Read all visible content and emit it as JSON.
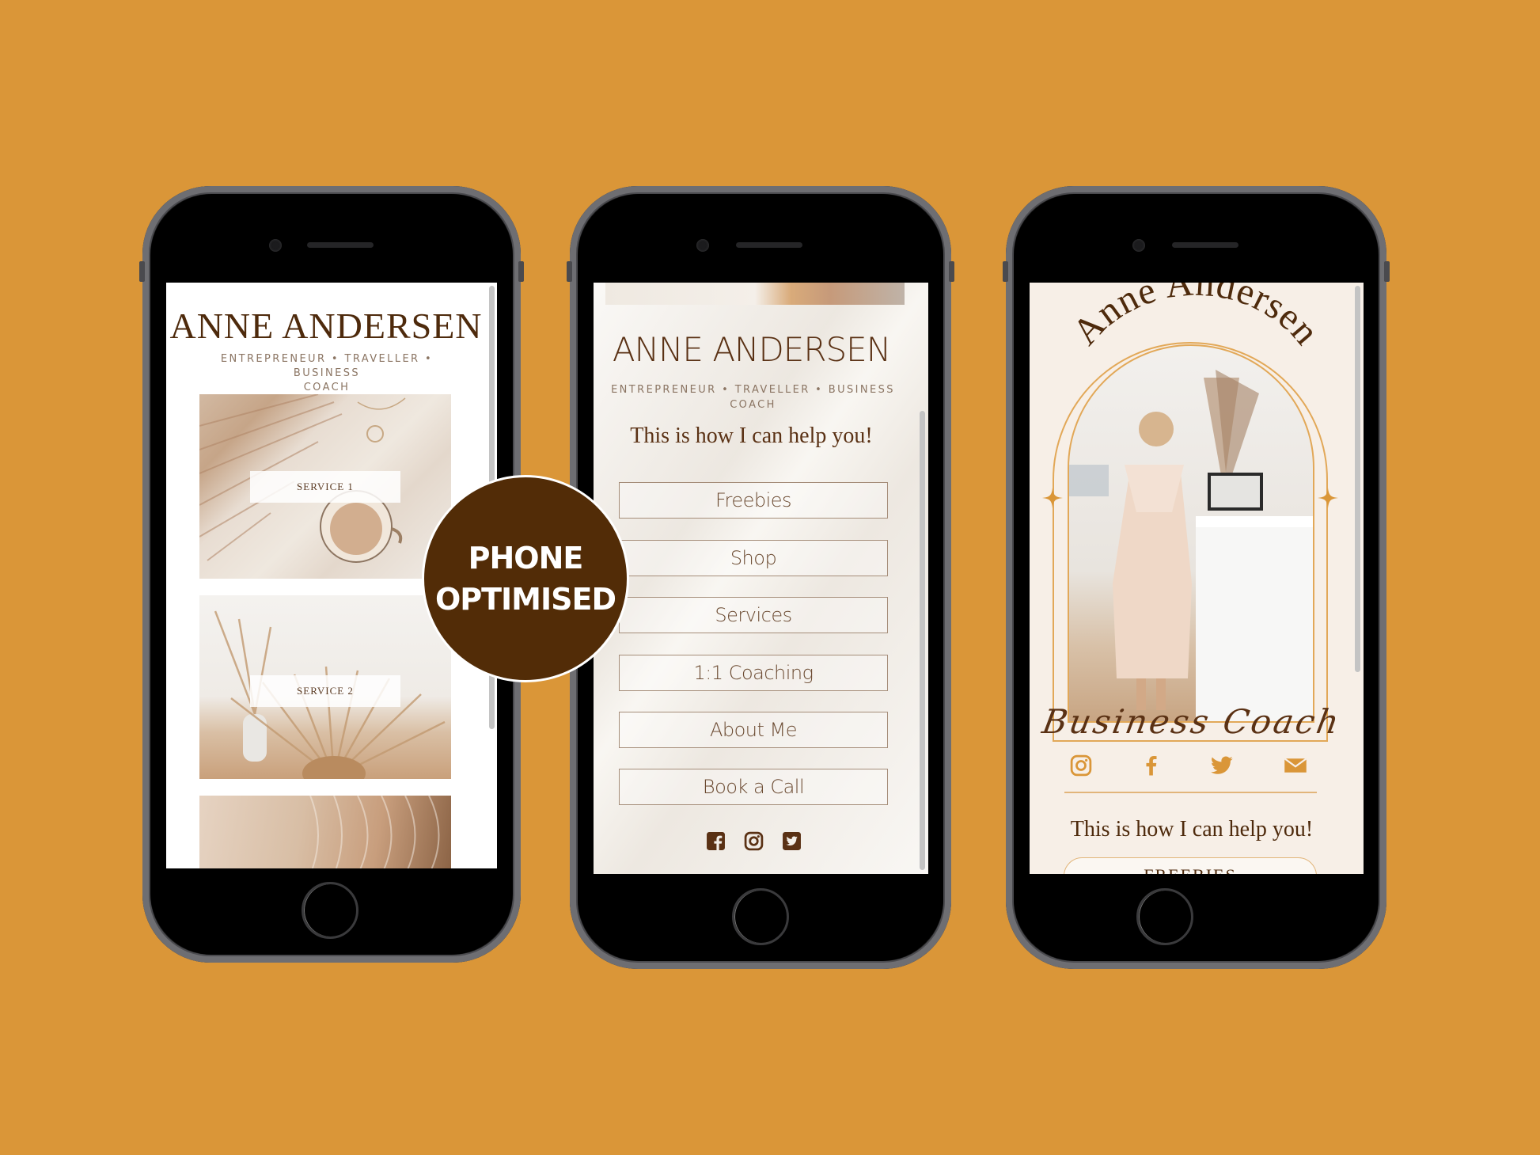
{
  "colors": {
    "background": "#DA9638",
    "brand_brown": "#522C07",
    "accent_gold": "#E2B57A",
    "icon_gold": "#DA9638"
  },
  "badge": {
    "line1": "PHONE",
    "line2": "OPTIMISED"
  },
  "phones": [
    {
      "name": "phone-1",
      "title": "ANNE ANDERSEN",
      "subtitle_line1": "ENTREPRENEUR • TRAVELLER • BUSINESS",
      "subtitle_line2": "COACH",
      "services": [
        {
          "label": "SERVICE 1",
          "image": "pampas-grass-and-coffee-photo"
        },
        {
          "label": "SERVICE 2",
          "image": "dried-wheat-vase-photo"
        },
        {
          "label": "",
          "image": "sand-texture-photo"
        }
      ]
    },
    {
      "name": "phone-2",
      "title": "ANNE ANDERSEN",
      "subtitle_line1": "ENTREPRENEUR • TRAVELLER • BUSINESS",
      "subtitle_line2": "COACH",
      "heading": "This is how I can help you!",
      "links": [
        "Freebies",
        "Shop",
        "Services",
        "1:1 Coaching",
        "About Me",
        "Book a Call"
      ],
      "social_icons": [
        "facebook-icon",
        "instagram-icon",
        "twitter-icon"
      ]
    },
    {
      "name": "phone-3",
      "title": "Anne Andersen",
      "tagline": "Business Coach",
      "photo": "woman-at-laptop-photo",
      "social_icons": [
        "instagram-icon",
        "facebook-icon",
        "twitter-icon",
        "email-icon"
      ],
      "heading": "This is how I can help you!",
      "links": [
        "FREEBIES",
        ""
      ]
    }
  ]
}
